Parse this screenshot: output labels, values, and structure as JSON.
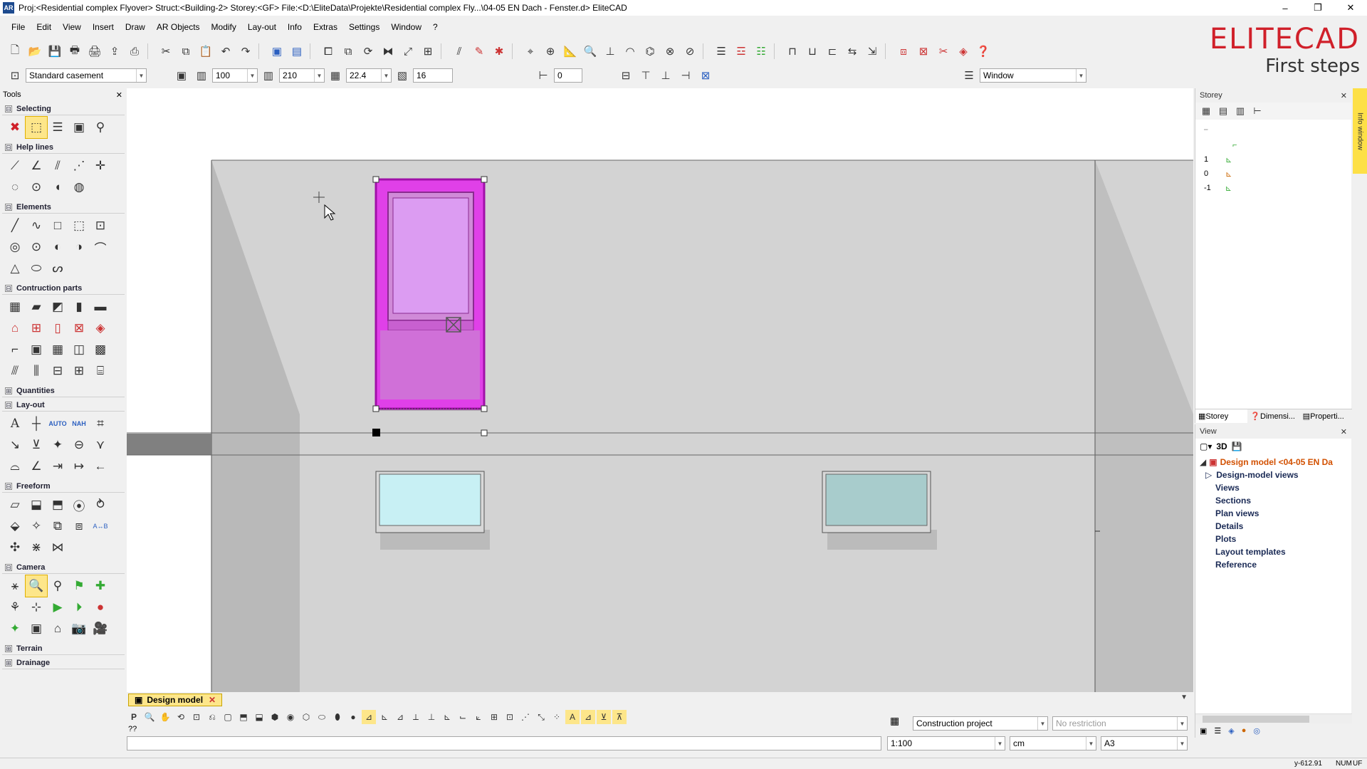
{
  "window": {
    "app_icon": "AR",
    "title": "Proj:<Residential complex Flyover> Struct:<Building-2> Storey:<GF> File:<D:\\EliteData\\Projekte\\Residential complex Fly...\\04-05 EN Dach - Fenster.d> EliteCAD",
    "minimize": "–",
    "restore": "❐",
    "close": "✕"
  },
  "menu": [
    "File",
    "Edit",
    "View",
    "Insert",
    "Draw",
    "AR Objects",
    "Modify",
    "Lay-out",
    "Info",
    "Extras",
    "Settings",
    "Window",
    "?"
  ],
  "logo": {
    "line1": "ELITECAD",
    "line2": "First steps"
  },
  "properties_bar": {
    "type_value": "Standard casement",
    "width_value": "100",
    "height_value": "210",
    "thickness_value": "22.4",
    "count_value": "16",
    "offset_value": "0",
    "layer_value": "Window"
  },
  "tools_panel": {
    "title": "Tools",
    "sections": {
      "selecting": "Selecting",
      "help_lines": "Help lines",
      "elements": "Elements",
      "construction": "Contruction parts",
      "quantities": "Quantities",
      "layout": "Lay-out",
      "freeform": "Freeform",
      "camera": "Camera",
      "terrain": "Terrain",
      "drainage": "Drainage"
    },
    "expanded_glyph": "⊟",
    "collapsed_glyph": "⊞"
  },
  "storey_panel": {
    "title": "Storey",
    "levels": [
      "1",
      "0",
      "-1"
    ],
    "tabs": [
      "Storey",
      "Dimensi...",
      "Properti..."
    ]
  },
  "view_panel": {
    "title": "View",
    "mode": "3D",
    "root": "Design model <04-05 EN Da",
    "items": [
      "Design-model views",
      "Views",
      "Sections",
      "Plan views",
      "Details",
      "Plots",
      "Layout templates",
      "Reference"
    ]
  },
  "info_window_tab": "Info window",
  "document_tab": "Design model",
  "command_prompt": "??",
  "bottom_controls": {
    "project": "Construction project",
    "restriction_placeholder": "No restriction",
    "scale": "1:100",
    "unit": "cm",
    "paper": "A3"
  },
  "status": {
    "coordinate": "y-612.91",
    "num": "NUM",
    "uf": "UF"
  },
  "colors": {
    "accent": "#d0202a",
    "selected_window": "#e040e8",
    "window_glass": "#c8f0f4",
    "wall": "#d3d3d3"
  },
  "icons": {
    "cancel": "cancel-icon",
    "select": "select-rectangle-icon",
    "zoom": "zoom-window-icon"
  }
}
